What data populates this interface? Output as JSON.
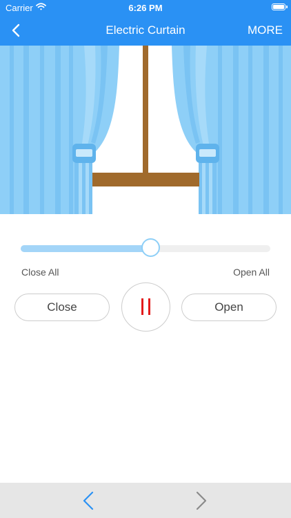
{
  "status_bar": {
    "carrier": "Carrier",
    "time": "6:26 PM",
    "wifi_icon": "wifi-icon",
    "battery_icon": "battery-icon"
  },
  "nav": {
    "title": "Electric Curtain",
    "more_label": "MORE",
    "back_icon": "chevron-left-icon"
  },
  "curtain": {
    "position_percent": 52,
    "close_all_label": "Close All",
    "open_all_label": "Open All"
  },
  "controls": {
    "close_label": "Close",
    "open_label": "Open",
    "pause_icon": "pause-icon"
  },
  "bottom_nav": {
    "prev_icon": "chevron-left-icon",
    "next_icon": "chevron-right-icon"
  },
  "colors": {
    "header_blue": "#2a91f4",
    "curtain_blue": "#8ecff7",
    "curtain_stripe": "#7ac3f3",
    "window_frame_brown": "#a06a2c",
    "pause_red": "#e31b1b",
    "bottom_bar_gray": "#e6e6e6"
  }
}
